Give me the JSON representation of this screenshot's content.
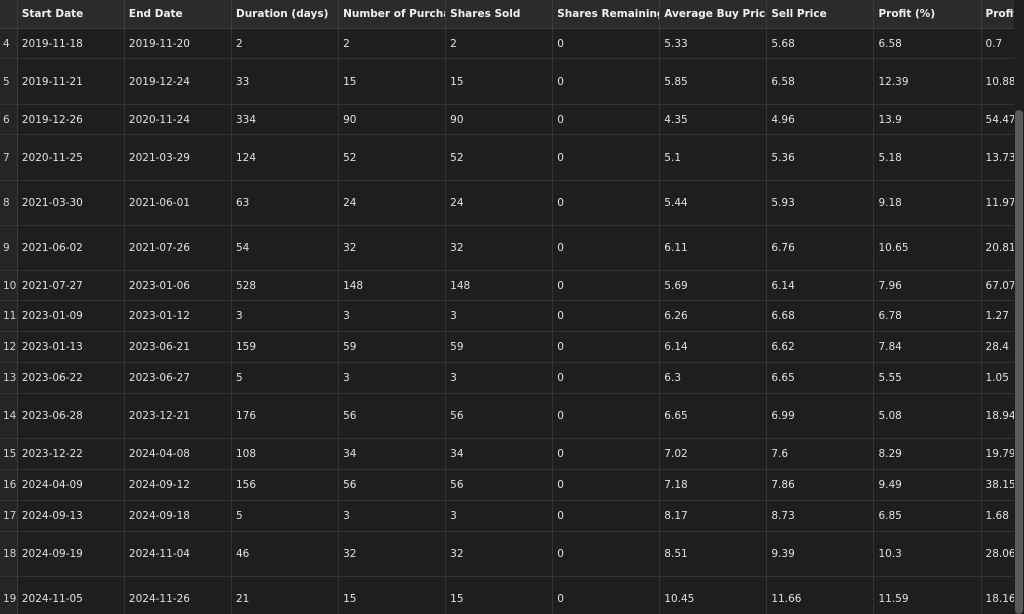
{
  "headers": [
    "",
    "Start Date",
    "End Date",
    "Duration (days)",
    "Number of Purchase",
    "Shares Sold",
    "Shares Remaining",
    "Average Buy Price",
    "Sell Price",
    "Profit (%)",
    "Profit (US"
  ],
  "rows": [
    [
      "4",
      "2019-11-18",
      "2019-11-20",
      "2",
      "2",
      "2",
      "0",
      "5.33",
      "5.68",
      "6.58",
      "0.7"
    ],
    [
      "5",
      "2019-11-21",
      "2019-12-24",
      "33",
      "15",
      "15",
      "0",
      "5.85",
      "6.58",
      "12.39",
      "10.88"
    ],
    [
      "6",
      "2019-12-26",
      "2020-11-24",
      "334",
      "90",
      "90",
      "0",
      "4.35",
      "4.96",
      "13.9",
      "54.47"
    ],
    [
      "7",
      "2020-11-25",
      "2021-03-29",
      "124",
      "52",
      "52",
      "0",
      "5.1",
      "5.36",
      "5.18",
      "13.73"
    ],
    [
      "8",
      "2021-03-30",
      "2021-06-01",
      "63",
      "24",
      "24",
      "0",
      "5.44",
      "5.93",
      "9.18",
      "11.97"
    ],
    [
      "9",
      "2021-06-02",
      "2021-07-26",
      "54",
      "32",
      "32",
      "0",
      "6.11",
      "6.76",
      "10.65",
      "20.81"
    ],
    [
      "10",
      "2021-07-27",
      "2023-01-06",
      "528",
      "148",
      "148",
      "0",
      "5.69",
      "6.14",
      "7.96",
      "67.07"
    ],
    [
      "11",
      "2023-01-09",
      "2023-01-12",
      "3",
      "3",
      "3",
      "0",
      "6.26",
      "6.68",
      "6.78",
      "1.27"
    ],
    [
      "12",
      "2023-01-13",
      "2023-06-21",
      "159",
      "59",
      "59",
      "0",
      "6.14",
      "6.62",
      "7.84",
      "28.4"
    ],
    [
      "13",
      "2023-06-22",
      "2023-06-27",
      "5",
      "3",
      "3",
      "0",
      "6.3",
      "6.65",
      "5.55",
      "1.05"
    ],
    [
      "14",
      "2023-06-28",
      "2023-12-21",
      "176",
      "56",
      "56",
      "0",
      "6.65",
      "6.99",
      "5.08",
      "18.94"
    ],
    [
      "15",
      "2023-12-22",
      "2024-04-08",
      "108",
      "34",
      "34",
      "0",
      "7.02",
      "7.6",
      "8.29",
      "19.79"
    ],
    [
      "16",
      "2024-04-09",
      "2024-09-12",
      "156",
      "56",
      "56",
      "0",
      "7.18",
      "7.86",
      "9.49",
      "38.15"
    ],
    [
      "17",
      "2024-09-13",
      "2024-09-18",
      "5",
      "3",
      "3",
      "0",
      "8.17",
      "8.73",
      "6.85",
      "1.68"
    ],
    [
      "18",
      "2024-09-19",
      "2024-11-04",
      "46",
      "32",
      "32",
      "0",
      "8.51",
      "9.39",
      "10.3",
      "28.06"
    ],
    [
      "19",
      "2024-11-05",
      "2024-11-26",
      "21",
      "15",
      "15",
      "0",
      "10.45",
      "11.66",
      "11.59",
      "18.16"
    ]
  ]
}
